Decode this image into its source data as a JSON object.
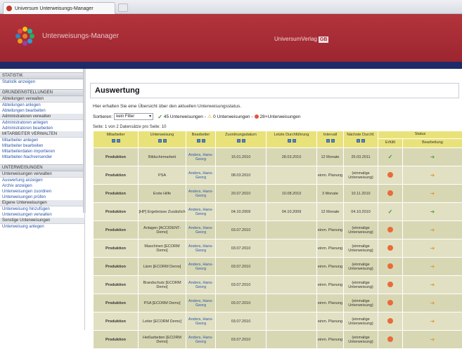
{
  "browser": {
    "tab_title": "Universum Unterweisungs-Manager"
  },
  "header": {
    "app_name": "Unterweisungs-Manager",
    "brand": "UniversumVerlag",
    "brand_tag": "GB",
    "colors": {
      "header": "#a52c35",
      "stripe": "#1f2a68",
      "logo_dots": [
        "#f0c419",
        "#2e86c1",
        "#e67e22",
        "#27ae60",
        "#8e44ad",
        "#e74c3c",
        "#1abc9c",
        "#f39c12",
        "#3498db"
      ]
    }
  },
  "sidebar": {
    "groups": [
      {
        "head": "STATISTIK",
        "links": [
          "Statistik anzeigen"
        ]
      },
      {
        "head": "GRUNDEINSTELLUNGEN",
        "subs": [
          {
            "label": "Abteilungen verwalten",
            "links": [
              "Abteilungen anlegen",
              "Abteilungen bearbeiten"
            ]
          },
          {
            "label": "Administratoren verwalten",
            "links": [
              "Administratoren anlegen",
              "Administratoren bearbeiten"
            ]
          },
          {
            "label": "MITARBEITER VERWALTEN",
            "links": [
              "Mitarbeiter anlegen",
              "Mitarbeiter bearbeiten",
              "Mitarbeiterdaten importieren",
              "Mitarbeiter-Nachversender"
            ]
          }
        ]
      },
      {
        "head": "UNTERWEISUNGEN",
        "subs": [
          {
            "label": "Unterweisungen verwalten",
            "links": [
              "Auswertung anzeigen",
              "Archiv anzeigen",
              "Unterweisungen zuordnen",
              "Unterweisungen prüfen"
            ]
          },
          {
            "label": "Eigene Unterweisungen",
            "links": [
              "Unterweisung hinzufügen",
              "Unterweisungen verwalten"
            ]
          },
          {
            "label": "Sonstige Unterweisungen",
            "links": [
              "Unterweisung anlegen"
            ]
          }
        ]
      }
    ]
  },
  "main": {
    "title": "Auswertung",
    "intro": "Hier erhalten Sie eine Übersicht über den aktuellen Unterweisungsstatus.",
    "filter": {
      "label": "Sortieren:",
      "selected": "kein Filter",
      "legend_ok": "45 Unterweisungen -",
      "legend_warn": "0 Unterweisungen -",
      "legend_red": "28+Unterweisungen"
    },
    "pager": "Seite: 1 von 2  Datensätze pro Seite: 10",
    "table": {
      "headers": [
        "Mitarbeiter",
        "Unterweisung",
        "Bearbeiter",
        "Zuordnungsdatum",
        "Letzte Durchführung",
        "Intervall",
        "Nächste Durchf.",
        "Status"
      ],
      "status_sub": [
        "Erfüllt",
        "Bearbeitung"
      ],
      "rows": [
        {
          "employee": "Produktion",
          "topic": "Bildschirmarbeit",
          "editor": "Anders, Hans-Georg",
          "assigned": "15.01.2010",
          "last": "28.03.2010",
          "interval": "12 Monate",
          "next": "25.03.2011",
          "status": "ok",
          "action": "arrow"
        },
        {
          "employee": "Produktion",
          "topic": "PSA",
          "editor": "Anders, Hans-Georg",
          "assigned": "08.03.2010",
          "last": "",
          "interval": "einm. Planung",
          "next": "(einmalige Unterweisung)",
          "status": "red",
          "action": "arrow"
        },
        {
          "employee": "Produktion",
          "topic": "Erste Hilfe",
          "editor": "Anders, Hans-Georg",
          "assigned": "20.07.2010",
          "last": "10.08.2010",
          "interval": "3 Monate",
          "next": "10.11.2010",
          "status": "red",
          "action": "arrow"
        },
        {
          "employee": "Produktion",
          "topic": "[HP] Ergebnisse Zusätzlich",
          "editor": "Anders, Hans-Georg",
          "assigned": "04.10.2009",
          "last": "04.10.2009",
          "interval": "12 Monate",
          "next": "04.10.2010",
          "status": "ok",
          "action": "arrow"
        },
        {
          "employee": "Produktion",
          "topic": "Anlagen [ACCIDENT-Demo]",
          "editor": "Anders, Hans-Georg",
          "assigned": "03.07.2010",
          "last": "",
          "interval": "einm. Planung",
          "next": "(einmalige Unterweisung)",
          "status": "red",
          "action": "arrow"
        },
        {
          "employee": "Produktion",
          "topic": "Maschinen [ECORM Demo]",
          "editor": "Anders, Hans-Georg",
          "assigned": "03.07.2010",
          "last": "",
          "interval": "einm. Planung",
          "next": "(einmalige Unterweisung)",
          "status": "red",
          "action": "arrow"
        },
        {
          "employee": "Produktion",
          "topic": "Lärm [ECORM Demo]",
          "editor": "Anders, Hans-Georg",
          "assigned": "03.07.2010",
          "last": "",
          "interval": "einm. Planung",
          "next": "(einmalige Unterweisung)",
          "status": "red",
          "action": "arrow"
        },
        {
          "employee": "Produktion",
          "topic": "Brandschutz [ECORM Demo]",
          "editor": "Anders, Hans-Georg",
          "assigned": "03.07.2010",
          "last": "",
          "interval": "einm. Planung",
          "next": "(einmalige Unterweisung)",
          "status": "red",
          "action": "arrow"
        },
        {
          "employee": "Produktion",
          "topic": "PSA [ECORM Demo]",
          "editor": "Anders, Hans-Georg",
          "assigned": "03.07.2010",
          "last": "",
          "interval": "einm. Planung",
          "next": "(einmalige Unterweisung)",
          "status": "red",
          "action": "arrow"
        },
        {
          "employee": "Produktion",
          "topic": "Leiter [ECORM Demo]",
          "editor": "Anders, Hans-Georg",
          "assigned": "03.07.2010",
          "last": "",
          "interval": "einm. Planung",
          "next": "(einmalige Unterweisung)",
          "status": "red",
          "action": "arrow"
        },
        {
          "employee": "Produktion",
          "topic": "Heißarbeiten [ECORM Demo]",
          "editor": "Anders, Hans-Georg",
          "assigned": "03.07.2010",
          "last": "",
          "interval": "einm. Planung",
          "next": "(einmalige Unterweisung)",
          "status": "red",
          "action": "arrow"
        }
      ]
    }
  }
}
